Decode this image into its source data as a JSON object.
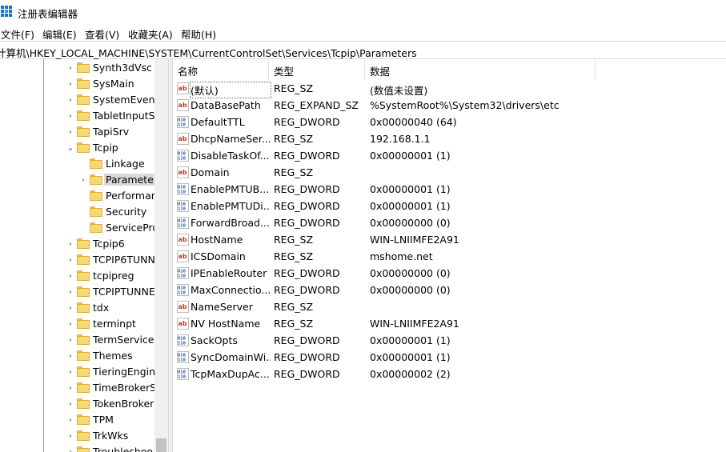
{
  "window": {
    "title": "注册表编辑器",
    "icon": "regedit-icon"
  },
  "menu": [
    "文件(F)",
    "编辑(E)",
    "查看(V)",
    "收藏夹(A)",
    "帮助(H)"
  ],
  "address": "计算机\\HKEY_LOCAL_MACHINE\\SYSTEM\\CurrentControlSet\\Services\\Tcpip\\Parameters",
  "tree": [
    {
      "label": "Synth3dVsc",
      "level": 1,
      "expander": "collapsed"
    },
    {
      "label": "SysMain",
      "level": 1,
      "expander": "collapsed"
    },
    {
      "label": "SystemEvents",
      "level": 1,
      "expander": "collapsed"
    },
    {
      "label": "TabletInputSe",
      "level": 1,
      "expander": "collapsed"
    },
    {
      "label": "TapiSrv",
      "level": 1,
      "expander": "collapsed"
    },
    {
      "label": "Tcpip",
      "level": 1,
      "expander": "expanded"
    },
    {
      "label": "Linkage",
      "level": 2,
      "expander": "none"
    },
    {
      "label": "Parameter",
      "level": 2,
      "expander": "collapsed",
      "selected": true
    },
    {
      "label": "Performan",
      "level": 2,
      "expander": "none"
    },
    {
      "label": "Security",
      "level": 2,
      "expander": "none"
    },
    {
      "label": "ServiceProv",
      "level": 2,
      "expander": "none"
    },
    {
      "label": "Tcpip6",
      "level": 1,
      "expander": "collapsed"
    },
    {
      "label": "TCPIP6TUNN",
      "level": 1,
      "expander": "collapsed"
    },
    {
      "label": "tcpipreg",
      "level": 1,
      "expander": "collapsed"
    },
    {
      "label": "TCPIPTUNNE",
      "level": 1,
      "expander": "collapsed"
    },
    {
      "label": "tdx",
      "level": 1,
      "expander": "collapsed"
    },
    {
      "label": "terminpt",
      "level": 1,
      "expander": "collapsed"
    },
    {
      "label": "TermService",
      "level": 1,
      "expander": "collapsed"
    },
    {
      "label": "Themes",
      "level": 1,
      "expander": "collapsed"
    },
    {
      "label": "TieringEngine",
      "level": 1,
      "expander": "collapsed"
    },
    {
      "label": "TimeBrokerS",
      "level": 1,
      "expander": "collapsed"
    },
    {
      "label": "TokenBroker",
      "level": 1,
      "expander": "collapsed"
    },
    {
      "label": "TPM",
      "level": 1,
      "expander": "collapsed"
    },
    {
      "label": "TrkWks",
      "level": 1,
      "expander": "collapsed"
    },
    {
      "label": "Troubleshoo",
      "level": 1,
      "expander": "collapsed"
    }
  ],
  "columns": {
    "name": "名称",
    "type": "类型",
    "data": "数据"
  },
  "values": [
    {
      "name": "(默认)",
      "type": "REG_SZ",
      "data": "(数值未设置)",
      "icon": "string-value-icon",
      "selected": true
    },
    {
      "name": "DataBasePath",
      "type": "REG_EXPAND_SZ",
      "data": "%SystemRoot%\\System32\\drivers\\etc",
      "icon": "string-value-icon"
    },
    {
      "name": "DefaultTTL",
      "type": "REG_DWORD",
      "data": "0x00000040 (64)",
      "icon": "binary-value-icon"
    },
    {
      "name": "DhcpNameSer...",
      "type": "REG_SZ",
      "data": "192.168.1.1",
      "icon": "string-value-icon"
    },
    {
      "name": "DisableTaskOf...",
      "type": "REG_DWORD",
      "data": "0x00000001 (1)",
      "icon": "binary-value-icon"
    },
    {
      "name": "Domain",
      "type": "REG_SZ",
      "data": "",
      "icon": "string-value-icon"
    },
    {
      "name": "EnablePMTUB...",
      "type": "REG_DWORD",
      "data": "0x00000001 (1)",
      "icon": "binary-value-icon"
    },
    {
      "name": "EnablePMTUDi...",
      "type": "REG_DWORD",
      "data": "0x00000001 (1)",
      "icon": "binary-value-icon"
    },
    {
      "name": "ForwardBroad...",
      "type": "REG_DWORD",
      "data": "0x00000000 (0)",
      "icon": "binary-value-icon"
    },
    {
      "name": "HostName",
      "type": "REG_SZ",
      "data": "WIN-LNIIMFE2A91",
      "icon": "string-value-icon"
    },
    {
      "name": "ICSDomain",
      "type": "REG_SZ",
      "data": "mshome.net",
      "icon": "string-value-icon"
    },
    {
      "name": "IPEnableRouter",
      "type": "REG_DWORD",
      "data": "0x00000000 (0)",
      "icon": "binary-value-icon"
    },
    {
      "name": "MaxConnectio...",
      "type": "REG_DWORD",
      "data": "0x00000000 (0)",
      "icon": "binary-value-icon"
    },
    {
      "name": "NameServer",
      "type": "REG_SZ",
      "data": "",
      "icon": "string-value-icon"
    },
    {
      "name": "NV HostName",
      "type": "REG_SZ",
      "data": "WIN-LNIIMFE2A91",
      "icon": "string-value-icon"
    },
    {
      "name": "SackOpts",
      "type": "REG_DWORD",
      "data": "0x00000001 (1)",
      "icon": "binary-value-icon"
    },
    {
      "name": "SyncDomainWi...",
      "type": "REG_DWORD",
      "data": "0x00000001 (1)",
      "icon": "binary-value-icon"
    },
    {
      "name": "TcpMaxDupAc...",
      "type": "REG_DWORD",
      "data": "0x00000002 (2)",
      "icon": "binary-value-icon"
    }
  ],
  "colors": {
    "string_icon": "#c0392b",
    "binary_icon": "#1f4e9a",
    "folder": "#f8d775",
    "selection": "#d9d9d9"
  }
}
